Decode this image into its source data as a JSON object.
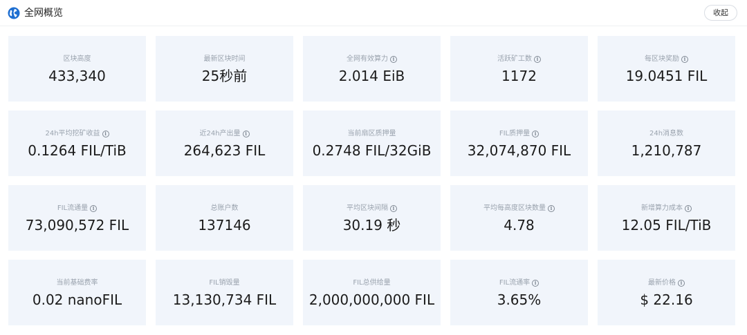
{
  "header": {
    "title": "全网概览",
    "collapse_label": "收起",
    "icon": "globe-icon"
  },
  "colors": {
    "card_bg": "#f1f5fb",
    "label": "#9aa3ae",
    "value": "#1b1b1b",
    "globe": "#1f6fd1"
  },
  "stats": [
    {
      "label": "区块高度",
      "value": "433,340",
      "info": false
    },
    {
      "label": "最新区块时间",
      "value": "25秒前",
      "info": false
    },
    {
      "label": "全网有效算力",
      "value": "2.014 EiB",
      "info": true
    },
    {
      "label": "活跃矿工数",
      "value": "1172",
      "info": true
    },
    {
      "label": "每区块奖励",
      "value": "19.0451 FIL",
      "info": true
    },
    {
      "label": "24h平均挖矿收益",
      "value": "0.1264 FIL/TiB",
      "info": true
    },
    {
      "label": "近24h产出量",
      "value": "264,623 FIL",
      "info": true
    },
    {
      "label": "当前扇区质押量",
      "value": "0.2748 FIL/32GiB",
      "info": false
    },
    {
      "label": "FIL质押量",
      "value": "32,074,870 FIL",
      "info": true
    },
    {
      "label": "24h消息数",
      "value": "1,210,787",
      "info": false
    },
    {
      "label": "FIL流通量",
      "value": "73,090,572 FIL",
      "info": true
    },
    {
      "label": "总账户数",
      "value": "137146",
      "info": false
    },
    {
      "label": "平均区块间隔",
      "value": "30.19 秒",
      "info": true
    },
    {
      "label": "平均每高度区块数量",
      "value": "4.78",
      "info": true
    },
    {
      "label": "新增算力成本",
      "value": "12.05 FIL/TiB",
      "info": true
    },
    {
      "label": "当前基础费率",
      "value": "0.02 nanoFIL",
      "info": false
    },
    {
      "label": "FIL销毁量",
      "value": "13,130,734 FIL",
      "info": false
    },
    {
      "label": "FIL总供给量",
      "value": "2,000,000,000 FIL",
      "info": false
    },
    {
      "label": "FIL流通率",
      "value": "3.65%",
      "info": true
    },
    {
      "label": "最新价格",
      "value": "$ 22.16",
      "info": true
    }
  ]
}
